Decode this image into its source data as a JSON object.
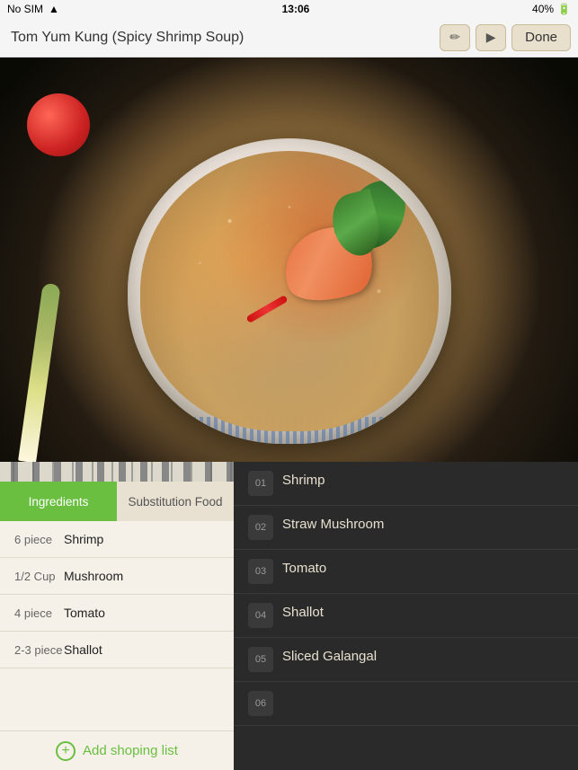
{
  "status_bar": {
    "carrier": "No SIM",
    "wifi_icon": "📶",
    "time": "13:06",
    "battery_pct": "40%"
  },
  "nav": {
    "title": "Tom Yum Kung (Spicy Shrimp Soup)",
    "icon_pencil": "✏",
    "icon_play": "▶",
    "done_label": "Done"
  },
  "tabs": {
    "ingredients_label": "Ingredients",
    "substitution_label": "Substitution Food"
  },
  "ingredients": [
    {
      "qty": "6 piece",
      "name": "Shrimp"
    },
    {
      "qty": "1/2 Cup",
      "name": "Mushroom"
    },
    {
      "qty": "4 piece",
      "name": "Tomato"
    },
    {
      "qty": "2-3 piece",
      "name": "Shallot"
    }
  ],
  "add_shopping": {
    "label": "Add shoping list"
  },
  "substitutions": [
    {
      "num": "01",
      "name": "Shrimp"
    },
    {
      "num": "02",
      "name": "Straw Mushroom"
    },
    {
      "num": "03",
      "name": "Tomato"
    },
    {
      "num": "04",
      "name": "Shallot"
    },
    {
      "num": "05",
      "name": "Sliced Galangal"
    },
    {
      "num": "06",
      "name": ""
    }
  ]
}
